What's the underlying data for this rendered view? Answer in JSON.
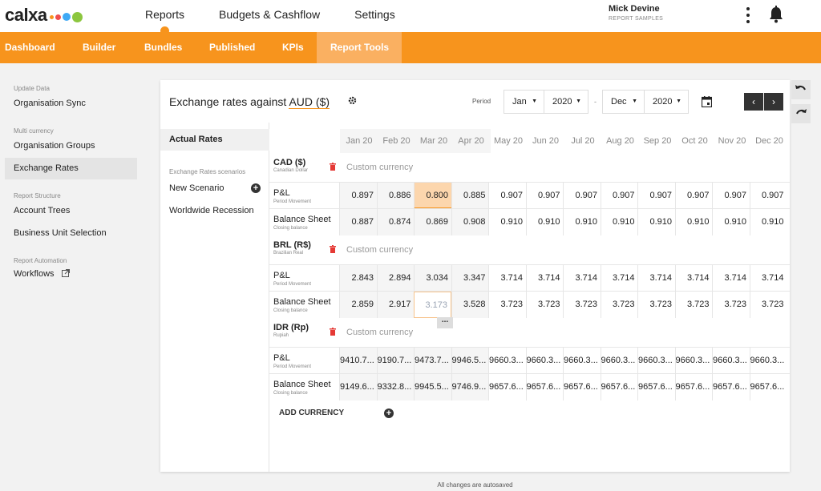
{
  "app": {
    "logo_text": "calxa",
    "logo_colors": [
      "#f7941d",
      "#f04e4e",
      "#3fa9f5",
      "#8cc63f"
    ]
  },
  "topnav": [
    "Reports",
    "Budgets & Cashflow",
    "Settings"
  ],
  "user": {
    "name": "Mick Devine",
    "org": "REPORT SAMPLES"
  },
  "subnav": [
    "Dashboard",
    "Builder",
    "Bundles",
    "Published",
    "KPIs",
    "Report Tools"
  ],
  "sidebar": {
    "update_data": "Update Data",
    "org_sync": "Organisation Sync",
    "multi_currency": "Multi currency",
    "org_groups": "Organisation Groups",
    "exchange_rates": "Exchange Rates",
    "report_structure": "Report Structure",
    "account_trees": "Account Trees",
    "bu_selection": "Business Unit Selection",
    "report_automation": "Report Automation",
    "workflows": "Workflows"
  },
  "main": {
    "title_prefix": "Exchange rates against",
    "title_currency": "AUD ($)",
    "period_label": "Period",
    "from_month": "Jan",
    "from_year": "2020",
    "to_month": "Dec",
    "to_year": "2020",
    "dash": "-"
  },
  "scenarios": {
    "actual": "Actual Rates",
    "label": "Exchange Rates scenarios",
    "new": "New Scenario",
    "worldwide": "Worldwide Recession"
  },
  "months": [
    "Jan 20",
    "Feb 20",
    "Mar 20",
    "Apr 20",
    "May 20",
    "Jun 20",
    "Jul 20",
    "Aug 20",
    "Sep 20",
    "Oct 20",
    "Nov 20",
    "Dec 20"
  ],
  "currencies": [
    {
      "code": "CAD ($)",
      "name": "Canadian Dollar",
      "desc": "Custom currency",
      "pl_label": "P&L",
      "pl_sub": "Period Movement",
      "pl": [
        "0.897",
        "0.886",
        "0.800",
        "0.885",
        "0.907",
        "0.907",
        "0.907",
        "0.907",
        "0.907",
        "0.907",
        "0.907",
        "0.907"
      ],
      "bs_label": "Balance Sheet",
      "bs_sub": "Closing balance",
      "bs": [
        "0.887",
        "0.874",
        "0.869",
        "0.908",
        "0.910",
        "0.910",
        "0.910",
        "0.910",
        "0.910",
        "0.910",
        "0.910",
        "0.910"
      ]
    },
    {
      "code": "BRL (R$)",
      "name": "Brazilian Real",
      "desc": "Custom currency",
      "pl_label": "P&L",
      "pl_sub": "Period Movement",
      "pl": [
        "2.843",
        "2.894",
        "3.034",
        "3.347",
        "3.714",
        "3.714",
        "3.714",
        "3.714",
        "3.714",
        "3.714",
        "3.714",
        "3.714"
      ],
      "bs_label": "Balance Sheet",
      "bs_sub": "Closing balance",
      "bs": [
        "2.859",
        "2.917",
        "3.173",
        "3.528",
        "3.723",
        "3.723",
        "3.723",
        "3.723",
        "3.723",
        "3.723",
        "3.723",
        "3.723"
      ]
    },
    {
      "code": "IDR (Rp)",
      "name": "Rupiah",
      "desc": "Custom currency",
      "pl_label": "P&L",
      "pl_sub": "Period Movement",
      "pl": [
        "9410.7...",
        "9190.7...",
        "9473.7...",
        "9946.5...",
        "9660.3...",
        "9660.3...",
        "9660.3...",
        "9660.3...",
        "9660.3...",
        "9660.3...",
        "9660.3...",
        "9660.3..."
      ],
      "bs_label": "Balance Sheet",
      "bs_sub": "Closing balance",
      "bs": [
        "9149.6...",
        "9332.8...",
        "9945.5...",
        "9746.9...",
        "9657.6...",
        "9657.6...",
        "9657.6...",
        "9657.6...",
        "9657.6...",
        "9657.6...",
        "9657.6...",
        "9657.6..."
      ]
    }
  ],
  "add_currency": "ADD CURRENCY",
  "more_label": "...",
  "autosave": "All changes are autosaved"
}
